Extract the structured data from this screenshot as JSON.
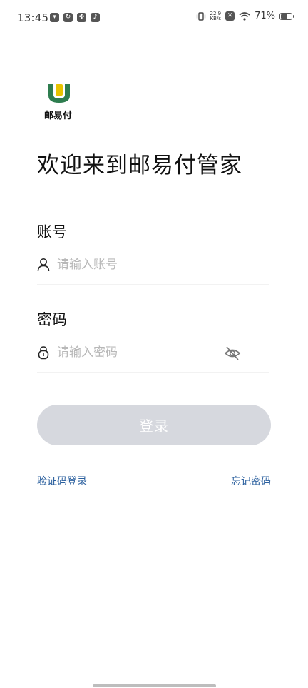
{
  "status_bar": {
    "time": "13:45",
    "net_speed_value": "22.9",
    "net_speed_unit": "KB/s",
    "battery_percent": "71%",
    "battery_level": 0.71,
    "icons": [
      "app-notification-icon",
      "refresh-app-icon",
      "pinwheel-app-icon",
      "tiktok-icon",
      "vibrate-icon",
      "sim-off-icon",
      "wifi-icon",
      "battery-icon"
    ]
  },
  "logo": {
    "text": "邮易付",
    "colors": {
      "green": "#2e7d4f",
      "yellow": "#e8c400"
    }
  },
  "welcome_title": "欢迎来到邮易付管家",
  "account": {
    "label": "账号",
    "placeholder": "请输入账号",
    "value": ""
  },
  "password": {
    "label": "密码",
    "placeholder": "请输入密码",
    "value": ""
  },
  "login_button": {
    "label": "登录",
    "color": "#d6d8de"
  },
  "links": {
    "sms_login": "验证码登录",
    "forgot_password": "忘记密码",
    "color": "#2a5f9e"
  }
}
